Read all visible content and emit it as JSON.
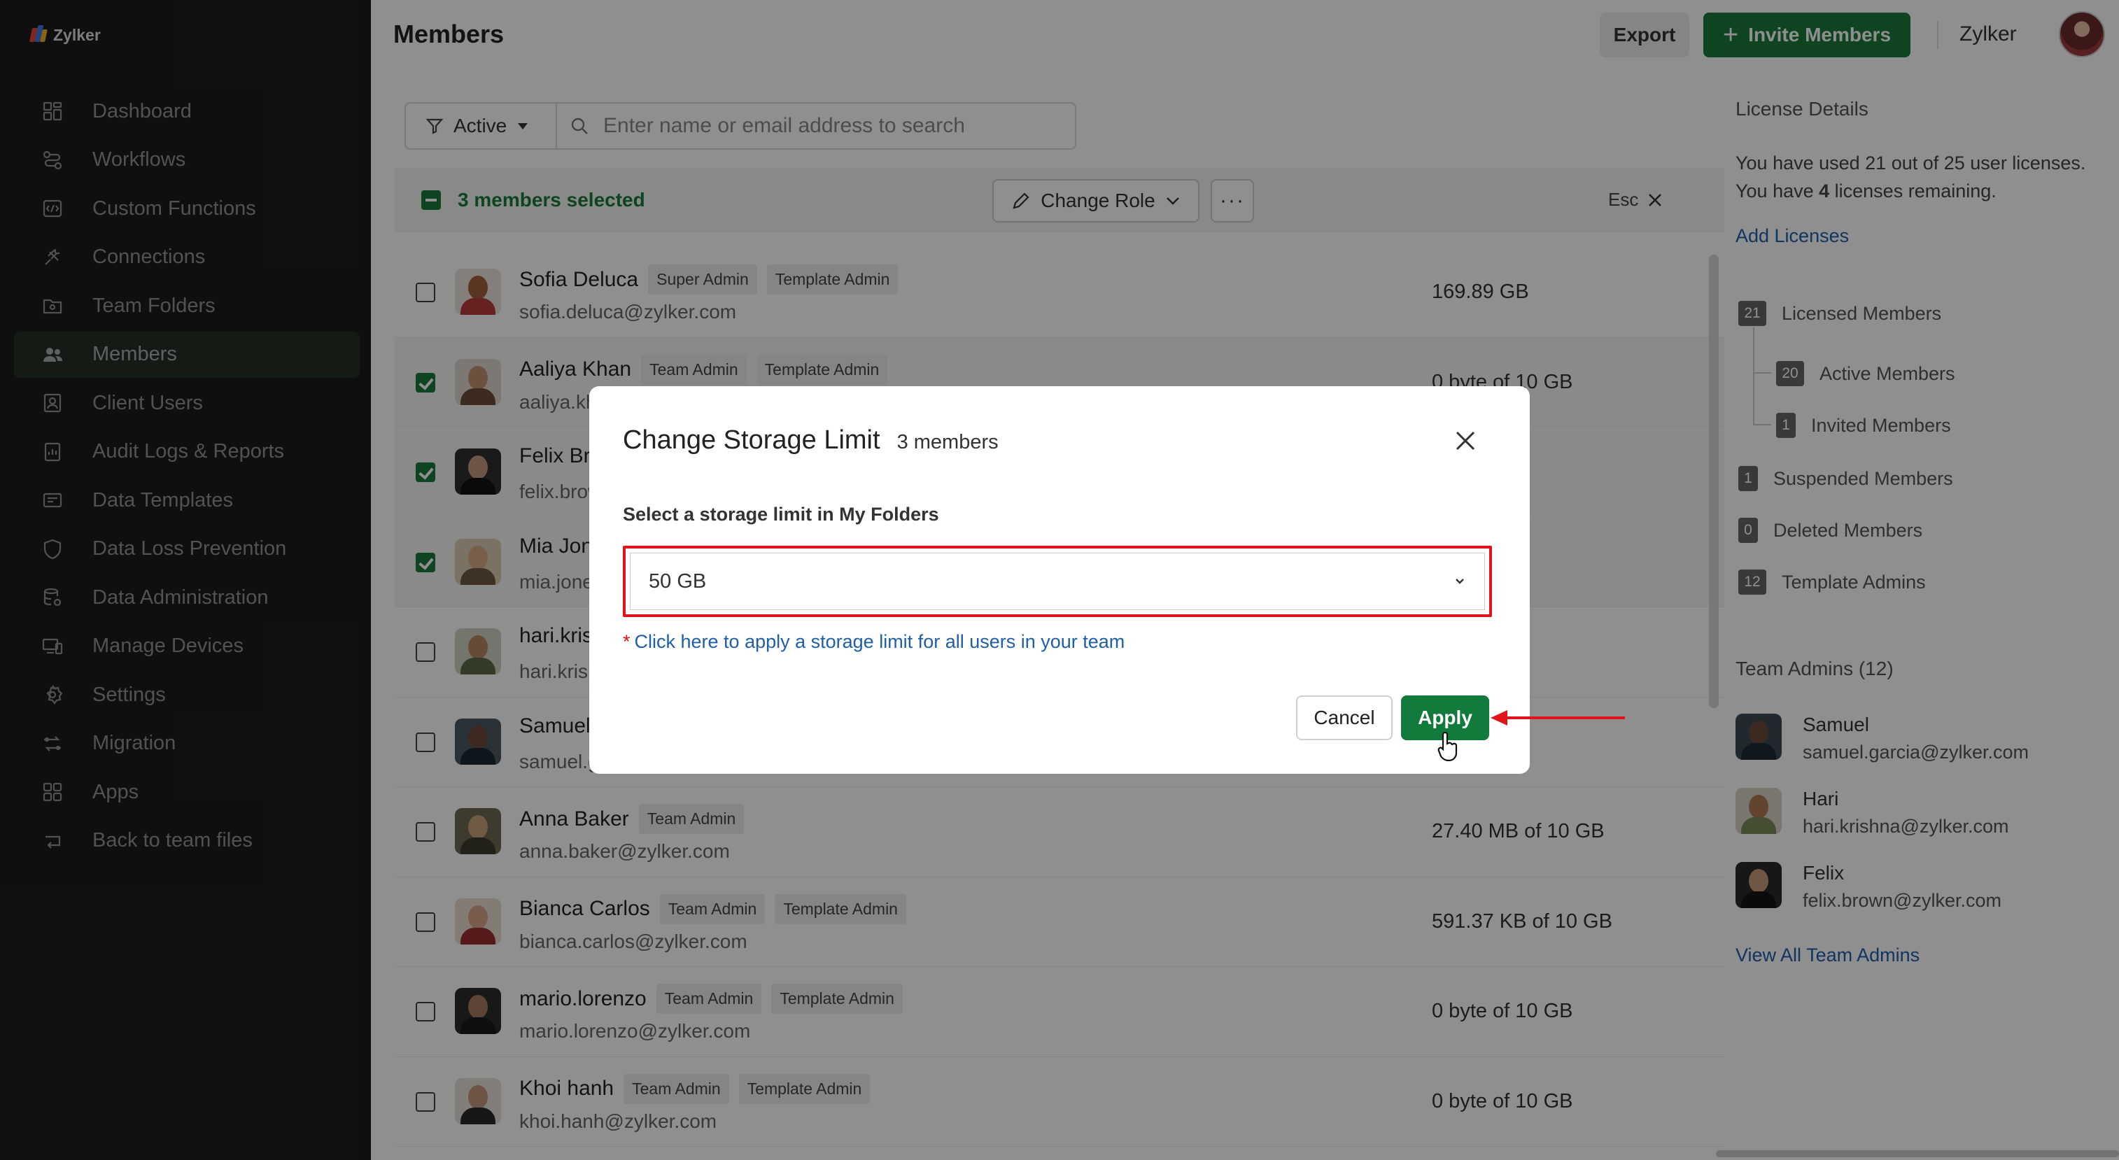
{
  "brand": {
    "name": "Zylker"
  },
  "sidebar": {
    "items": [
      {
        "label": "Dashboard",
        "icon": "dashboard-icon"
      },
      {
        "label": "Workflows",
        "icon": "workflows-icon"
      },
      {
        "label": "Custom Functions",
        "icon": "custom-functions-icon"
      },
      {
        "label": "Connections",
        "icon": "connections-icon"
      },
      {
        "label": "Team Folders",
        "icon": "team-folders-icon"
      },
      {
        "label": "Members",
        "icon": "members-icon",
        "active": true
      },
      {
        "label": "Client Users",
        "icon": "client-users-icon"
      },
      {
        "label": "Audit Logs & Reports",
        "icon": "audit-logs-icon"
      },
      {
        "label": "Data Templates",
        "icon": "data-templates-icon"
      },
      {
        "label": "Data Loss Prevention",
        "icon": "shield-icon"
      },
      {
        "label": "Data Administration",
        "icon": "data-administration-icon"
      },
      {
        "label": "Manage Devices",
        "icon": "devices-icon"
      },
      {
        "label": "Settings",
        "icon": "gear-icon"
      },
      {
        "label": "Migration",
        "icon": "migration-icon"
      },
      {
        "label": "Apps",
        "icon": "apps-icon"
      },
      {
        "label": "Back to team files",
        "icon": "back-icon"
      }
    ]
  },
  "header": {
    "title": "Members",
    "export_label": "Export",
    "invite_label": "Invite Members",
    "org_name": "Zylker"
  },
  "filter": {
    "status": "Active",
    "search_placeholder": "Enter name or email address to search"
  },
  "selection": {
    "text": "3 members selected",
    "change_role_label": "Change Role",
    "more_label": "···",
    "esc_label": "Esc"
  },
  "members": [
    {
      "name": "Sofia Deluca",
      "tags": [
        "Super Admin",
        "Template Admin"
      ],
      "email": "sofia.deluca@zylker.com",
      "storage": "169.89 GB",
      "checked": false
    },
    {
      "name": "Aaliya Khan",
      "tags": [
        "Team Admin",
        "Template Admin"
      ],
      "email": "aaliya.khan@zylker.com",
      "storage": "0 byte of 10 GB",
      "checked": true
    },
    {
      "name": "Felix Brown",
      "tags": [],
      "email": "felix.brown@zylker.com",
      "storage": "",
      "checked": true
    },
    {
      "name": "Mia Jones",
      "tags": [],
      "email": "mia.jones@zylker.com",
      "storage": "",
      "checked": true
    },
    {
      "name": "hari.krishna",
      "tags": [],
      "email": "hari.krishna@zylker.com",
      "storage": "",
      "checked": false
    },
    {
      "name": "Samuel",
      "tags": [],
      "email": "samuel.garcia@zylker.com",
      "storage": "",
      "checked": false
    },
    {
      "name": "Anna Baker",
      "tags": [
        "Team Admin"
      ],
      "email": "anna.baker@zylker.com",
      "storage": "27.40 MB of 10 GB",
      "checked": false
    },
    {
      "name": "Bianca Carlos",
      "tags": [
        "Team Admin",
        "Template Admin"
      ],
      "email": "bianca.carlos@zylker.com",
      "storage": "591.37 KB of 10 GB",
      "checked": false
    },
    {
      "name": "mario.lorenzo",
      "tags": [
        "Team Admin",
        "Template Admin"
      ],
      "email": "mario.lorenzo@zylker.com",
      "storage": "0 byte of 10 GB",
      "checked": false
    },
    {
      "name": "Khoi hanh",
      "tags": [
        "Team Admin",
        "Template Admin"
      ],
      "email": "khoi.hanh@zylker.com",
      "storage": "0 byte of 10 GB",
      "checked": false
    }
  ],
  "license": {
    "title": "License Details",
    "line1": "You have used 21 out of 25 user licenses.",
    "line2_prefix": "You have ",
    "line2_count": "4",
    "line2_suffix": " licenses remaining.",
    "add_link": "Add Licenses",
    "rows": [
      {
        "count": "21",
        "label": "Licensed Members"
      },
      {
        "count": "20",
        "label": "Active Members"
      },
      {
        "count": "1",
        "label": "Invited Members"
      },
      {
        "count": "1",
        "label": "Suspended Members"
      },
      {
        "count": "0",
        "label": "Deleted Members"
      },
      {
        "count": "12",
        "label": "Template Admins"
      }
    ]
  },
  "team_admins": {
    "title": "Team Admins (12)",
    "admins": [
      {
        "name": "Samuel",
        "email": "samuel.garcia@zylker.com"
      },
      {
        "name": "Hari",
        "email": "hari.krishna@zylker.com"
      },
      {
        "name": "Felix",
        "email": "felix.brown@zylker.com"
      }
    ],
    "view_all": "View All Team Admins"
  },
  "modal": {
    "title": "Change Storage Limit",
    "subtitle": "3 members",
    "field_label": "Select a storage limit in My Folders",
    "selected_value": "50 GB",
    "apply_all_star": "*",
    "apply_all_link": "Click here to apply a storage limit for all users in your team",
    "cancel_label": "Cancel",
    "apply_label": "Apply"
  },
  "colors": {
    "brand_green": "#1a7a3a",
    "highlight_red": "#e0141b",
    "link_blue": "#1f5fa8",
    "sidebar_bg": "#1c1c1c"
  }
}
